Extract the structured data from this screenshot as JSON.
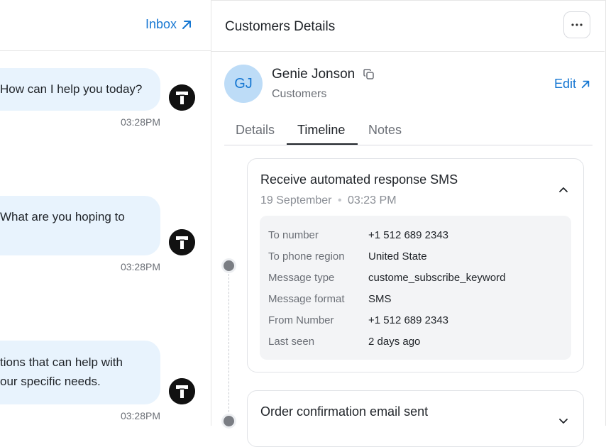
{
  "chat": {
    "inbox_label": "Inbox",
    "messages": [
      {
        "text_lines": [
          "How can I help you today?"
        ],
        "time": "03:28PM"
      },
      {
        "text_lines": [
          "What are you hoping to",
          ""
        ],
        "time": "03:28PM"
      },
      {
        "text_lines": [
          "tions that can help with",
          "our specific needs."
        ],
        "time": "03:28PM"
      }
    ]
  },
  "details": {
    "title": "Customers Details",
    "more_label": "···",
    "customer": {
      "initials": "GJ",
      "name": "Genie Jonson",
      "role": "Customers"
    },
    "edit_label": "Edit",
    "tabs": [
      {
        "label": "Details",
        "active": false
      },
      {
        "label": "Timeline",
        "active": true
      },
      {
        "label": "Notes",
        "active": false
      }
    ],
    "timeline": [
      {
        "title": "Receive automated response SMS",
        "date": "19 September",
        "time": "03:23 PM",
        "expanded": true,
        "fields": [
          {
            "label": "To number",
            "value": "+1 512 689 2343"
          },
          {
            "label": "To phone region",
            "value": "United State"
          },
          {
            "label": "Message type",
            "value": "custome_subscribe_keyword"
          },
          {
            "label": "Message format",
            "value": "SMS"
          },
          {
            "label": "From Number",
            "value": "+1 512 689 2343"
          },
          {
            "label": "Last seen",
            "value": "2 days ago"
          }
        ]
      },
      {
        "title": "Order confirmation email sent",
        "expanded": false
      }
    ]
  },
  "icons": {
    "inbox": "arrow-up-right-icon",
    "edit": "arrow-up-right-icon",
    "copy": "copy-icon",
    "agent_avatar": "t-logo-icon",
    "collapse": "chevron-up-icon",
    "expand": "chevron-down-icon"
  },
  "colors": {
    "accent": "#1677d2",
    "bubble": "#e8f3fd",
    "avatar_bg": "#bddcf7"
  }
}
